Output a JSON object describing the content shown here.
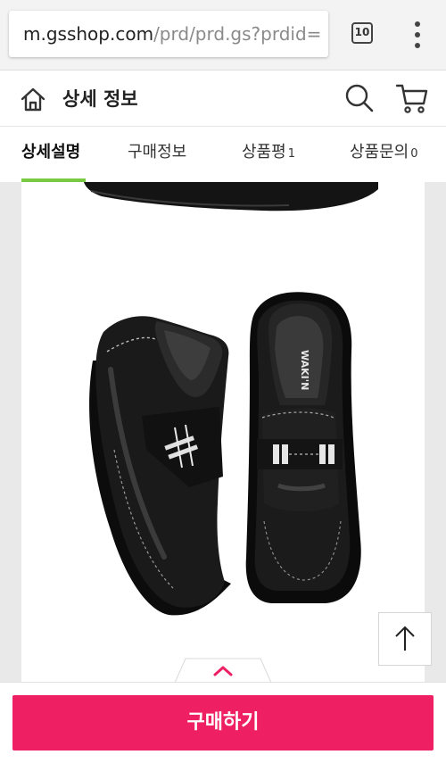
{
  "browser": {
    "url_host": "m.gsshop.com",
    "url_path": "/prd/prd.gs?prdid=",
    "tab_count": "10"
  },
  "header": {
    "title": "상세 정보"
  },
  "tabs": [
    {
      "label": "상세설명",
      "count": ""
    },
    {
      "label": "구매정보",
      "count": ""
    },
    {
      "label": "상품평",
      "count": "1"
    },
    {
      "label": "상품문의",
      "count": "0"
    }
  ],
  "product": {
    "insole_brand": "WAKI'N"
  },
  "buy_bar": {
    "buy_label": "구매하기"
  },
  "colors": {
    "accent": "#ee1f63",
    "tab_indicator": "#7ac943"
  }
}
